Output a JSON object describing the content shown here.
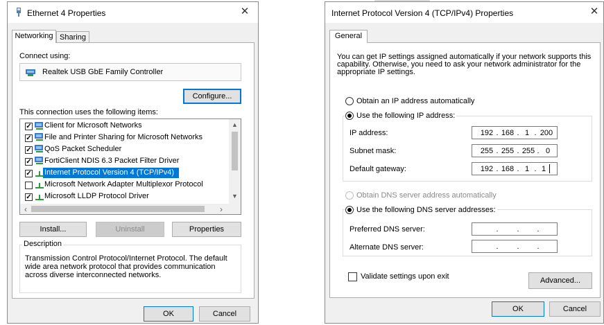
{
  "left_dialog": {
    "title": "Ethernet 4 Properties",
    "tabs": [
      {
        "label": "Networking",
        "active": true
      },
      {
        "label": "Sharing",
        "active": false
      }
    ],
    "connect_using_label": "Connect using:",
    "adapter_name": "Realtek USB GbE Family Controller",
    "configure_label": "Configure...",
    "items_label": "This connection uses the following items:",
    "items": [
      {
        "label": "Client for Microsoft Networks",
        "checked": true,
        "icon": "network-client-icon"
      },
      {
        "label": "File and Printer Sharing for Microsoft Networks",
        "checked": true,
        "icon": "network-service-icon"
      },
      {
        "label": "QoS Packet Scheduler",
        "checked": true,
        "icon": "network-service-icon"
      },
      {
        "label": "FortiClient NDIS 6.3 Packet Filter Driver",
        "checked": true,
        "icon": "network-service-icon"
      },
      {
        "label": "Internet Protocol Version 4 (TCP/IPv4)",
        "checked": true,
        "icon": "protocol-icon",
        "selected": true
      },
      {
        "label": "Microsoft Network Adapter Multiplexor Protocol",
        "checked": false,
        "icon": "protocol-icon"
      },
      {
        "label": "Microsoft LLDP Protocol Driver",
        "checked": true,
        "icon": "protocol-icon"
      }
    ],
    "install_label": "Install...",
    "uninstall_label": "Uninstall",
    "properties_label": "Properties",
    "description_label": "Description",
    "description_text": "Transmission Control Protocol/Internet Protocol. The default wide area network protocol that provides communication across diverse interconnected networks.",
    "ok_label": "OK",
    "cancel_label": "Cancel"
  },
  "right_dialog": {
    "title": "Internet Protocol Version 4 (TCP/IPv4) Properties",
    "tab": "General",
    "intro": "You can get IP settings assigned automatically if your network supports this capability. Otherwise, you need to ask your network administrator for the appropriate IP settings.",
    "obtain_ip_auto": "Obtain an IP address automatically",
    "use_following_ip": "Use the following IP address:",
    "ip_label": "IP address:",
    "ip": [
      "192",
      "168",
      "1",
      "200"
    ],
    "subnet_label": "Subnet mask:",
    "subnet": [
      "255",
      "255",
      "255",
      "0"
    ],
    "gateway_label": "Default gateway:",
    "gateway": [
      "192",
      "168",
      "1",
      "1"
    ],
    "obtain_dns_auto": "Obtain DNS server address automatically",
    "use_following_dns": "Use the following DNS server addresses:",
    "preferred_dns_label": "Preferred DNS server:",
    "alternate_dns_label": "Alternate DNS server:",
    "validate_label": "Validate settings upon exit",
    "advanced_label": "Advanced...",
    "ok_label": "OK",
    "cancel_label": "Cancel"
  },
  "colors": {
    "selection": "#0078d7",
    "dialog_bg": "#f0f0f0"
  }
}
